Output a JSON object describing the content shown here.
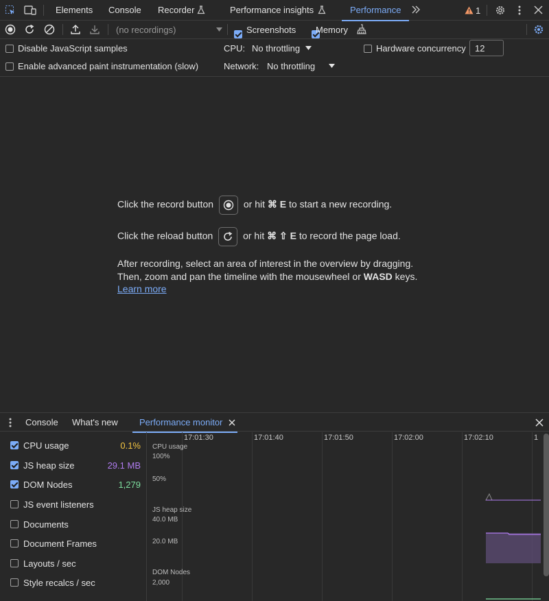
{
  "tabs": [
    {
      "label": "Elements"
    },
    {
      "label": "Console"
    },
    {
      "label": "Recorder"
    },
    {
      "label": "Performance insights"
    },
    {
      "label": "Performance"
    }
  ],
  "warnings_count": "1",
  "toolbar": {
    "recording_select": "(no recordings)",
    "screenshots_label": "Screenshots",
    "memory_label": "Memory"
  },
  "settings": {
    "disable_js_samples": "Disable JavaScript samples",
    "advanced_paint": "Enable advanced paint instrumentation (slow)",
    "cpu_label": "CPU:",
    "cpu_value": "No throttling",
    "network_label": "Network:",
    "network_value": "No throttling",
    "hw_concurrency_label": "Hardware concurrency",
    "hw_concurrency_value": "12"
  },
  "landing": {
    "record_pre": "Click the record button",
    "record_post_1": "or hit",
    "record_key": "⌘ E",
    "record_post_2": "to start a new recording.",
    "reload_pre": "Click the reload button",
    "reload_post_1": "or hit",
    "reload_key": "⌘ ⇧ E",
    "reload_post_2": "to record the page load.",
    "line3": "After recording, select an area of interest in the overview by dragging.",
    "line4_pre": "Then, zoom and pan the timeline with the mousewheel or",
    "line4_keys": "WASD",
    "line4_post": "keys.",
    "learn_more": "Learn more"
  },
  "drawer": {
    "tabs": [
      {
        "label": "Console"
      },
      {
        "label": "What's new"
      },
      {
        "label": "Performance monitor"
      }
    ]
  },
  "metrics": [
    {
      "label": "CPU usage",
      "value": "0.1%",
      "checked": true,
      "color": "#f4c542"
    },
    {
      "label": "JS heap size",
      "value": "29.1 MB",
      "checked": true,
      "color": "#b07cf0"
    },
    {
      "label": "DOM Nodes",
      "value": "1,279",
      "checked": true,
      "color": "#7ee0a0"
    },
    {
      "label": "JS event listeners",
      "value": "",
      "checked": false
    },
    {
      "label": "Documents",
      "value": "",
      "checked": false
    },
    {
      "label": "Document Frames",
      "value": "",
      "checked": false
    },
    {
      "label": "Layouts / sec",
      "value": "",
      "checked": false
    },
    {
      "label": "Style recalcs / sec",
      "value": "",
      "checked": false
    }
  ],
  "graph": {
    "times": [
      "17:01:30",
      "17:01:40",
      "17:01:50",
      "17:02:00",
      "17:02:10",
      "1"
    ],
    "cpu_title": "CPU usage",
    "cpu_ticks": [
      "100%",
      "50%"
    ],
    "heap_title": "JS heap size",
    "heap_ticks": [
      "40.0 MB",
      "20.0 MB"
    ],
    "dom_title": "DOM Nodes",
    "dom_ticks": [
      "2,000"
    ]
  }
}
